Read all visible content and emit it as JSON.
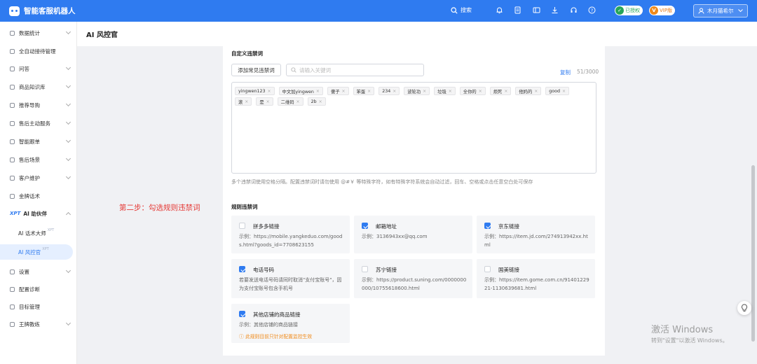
{
  "app": {
    "title": "智能客服机器人"
  },
  "topbar": {
    "search_label": "搜索",
    "badge_authorized": "已授权",
    "badge_vip": "VIP版",
    "vip_icon_letter": "V",
    "user_name": "木月猫希尔"
  },
  "sidebar": {
    "items": [
      {
        "label": "数据统计"
      },
      {
        "label": "全自动接待管理"
      },
      {
        "label": "问答"
      },
      {
        "label": "商品知识库"
      },
      {
        "label": "推荐导购"
      },
      {
        "label": "售后主动服务"
      },
      {
        "label": "智能跟单"
      },
      {
        "label": "售后场景"
      },
      {
        "label": "客户维护"
      },
      {
        "label": "金牌话术"
      },
      {
        "label": "AI 助伙伴",
        "prefix": "XPT"
      },
      {
        "label": "AI 话术大师",
        "sup": "XPT"
      },
      {
        "label": "AI 风控官",
        "sup": "XPT"
      },
      {
        "label": "设置"
      },
      {
        "label": "配置诊断"
      },
      {
        "label": "目标管理"
      },
      {
        "label": "王牌教练"
      }
    ]
  },
  "page": {
    "title": "AI 风控官"
  },
  "custom_words": {
    "section_title": "自定义违禁词",
    "add_button": "添加常见违禁词",
    "search_placeholder": "请输入关键词",
    "copy_label": "复制",
    "count": "51/3000",
    "tags": [
      "yingwen123",
      "中文加yingwen",
      "傻子",
      "笨蛋",
      "234",
      "波轮功",
      "垃圾",
      "全你的",
      "烦死",
      "他妈的",
      "good",
      "滚",
      "是",
      "二维码",
      "2b"
    ],
    "hint": "多个违禁词使用空格分隔。配置违禁词时请勿使用 @#￥ 等特殊字符，如有特殊字符系统会自动过滤，回车、空格或点击任意空白处可保存"
  },
  "rules": {
    "section_title": "规则违禁词",
    "items": [
      {
        "name": "拼多多链接",
        "checked": false,
        "desc": "示例：https://mobile.yangkeduo.com/goods.html?goods_id=7708623155"
      },
      {
        "name": "邮箱地址",
        "checked": true,
        "desc": "示例：3136943xx@qq.com"
      },
      {
        "name": "京东链接",
        "checked": true,
        "desc": "示例：https://item.jd.com/274913942xx.html"
      },
      {
        "name": "电话号码",
        "checked": true,
        "desc": "若要发送电话号码请同时取消\"支付宝账号\"，因为支付宝账号包含手机号"
      },
      {
        "name": "苏宁链接",
        "checked": false,
        "desc": "示例：https://product.suning.com/0000000000/10755618600.html"
      },
      {
        "name": "国美链接",
        "checked": false,
        "desc": "示例：https://item.gome.com.cn/9140122921-1130639681.html"
      },
      {
        "name": "其他店铺的商品链接",
        "checked": true,
        "desc": "示例：其他店铺的商品链接",
        "warning": "ⓘ 此规则目前只针对配置监控生效"
      }
    ]
  },
  "annotation": "第二步：勾选规则违禁词",
  "watermark": {
    "line1": "激活 Windows",
    "line2": "转到\"设置\"以激活 Windows。"
  },
  "colors": {
    "primary": "#2f7bf0",
    "annotation": "#e53935",
    "warning": "#f08a1a",
    "success": "#27a55a"
  }
}
